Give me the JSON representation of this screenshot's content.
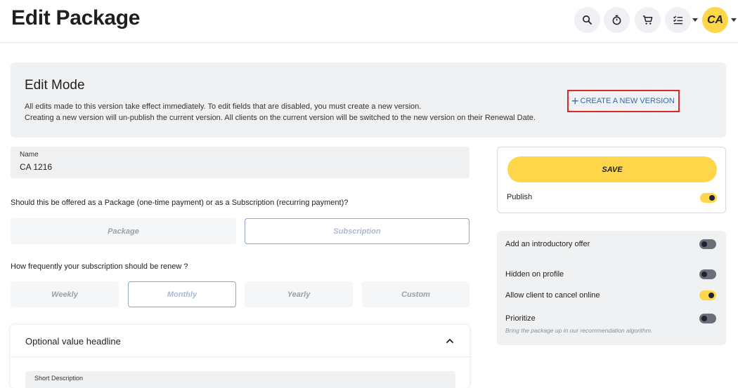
{
  "header": {
    "title": "Edit Package",
    "avatar_initials": "CA"
  },
  "edit_mode": {
    "title": "Edit Mode",
    "line1": "All edits made to this version take effect immediately. To edit fields that are disabled, you must create a new version.",
    "line2": "Creating a new version will un-publish the current version. All clients on the current version will be switched to the new version on their Renewal Date.",
    "create_version_label": "CREATE A NEW VERSION"
  },
  "name_field": {
    "label": "Name",
    "value": "CA 1216"
  },
  "payment_type": {
    "question": "Should this be offered as a Package (one-time payment) or as a Subscription (recurring payment)?",
    "options": [
      "Package",
      "Subscription"
    ],
    "selected": "Subscription"
  },
  "renewal": {
    "question": "How frequently your subscription should be renew ?",
    "options": [
      "Weekly",
      "Monthly",
      "Yearly",
      "Custom"
    ],
    "selected": "Monthly"
  },
  "optional_card": {
    "title": "Optional value headline",
    "short_description_label": "Short Description"
  },
  "save_panel": {
    "save_label": "SAVE",
    "publish_label": "Publish",
    "publish_on": true
  },
  "options": [
    {
      "label": "Add an introductory offer",
      "on": false
    },
    {
      "label": "Hidden on profile",
      "on": false
    },
    {
      "label": "Allow client to cancel online",
      "on": true
    },
    {
      "label": "Prioritize",
      "on": false,
      "sub": "Bring the package up in our recommendation algorithm."
    }
  ],
  "colors": {
    "accent": "#ffd54a",
    "link": "#3b6aa8",
    "highlight_border": "#d42a2a"
  }
}
